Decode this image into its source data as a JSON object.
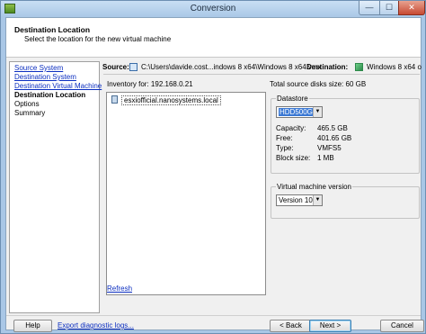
{
  "window": {
    "title": "Conversion",
    "minimize_glyph": "—",
    "maximize_glyph": "☐",
    "close_glyph": "✕"
  },
  "header": {
    "title": "Destination Location",
    "subtitle": "Select the location for the new virtual machine"
  },
  "steps": [
    {
      "label": "Source System",
      "state": "link"
    },
    {
      "label": "Destination System",
      "state": "link"
    },
    {
      "label": "Destination Virtual Machine",
      "state": "link"
    },
    {
      "label": "Destination Location",
      "state": "current"
    },
    {
      "label": "Options",
      "state": "pending"
    },
    {
      "label": "Summary",
      "state": "pending"
    }
  ],
  "source": {
    "label": "Source:",
    "value": "C:\\Users\\davide.cost...indows 8 x64\\Windows 8 x64.vmx",
    "icon": "vmx-file-icon"
  },
  "destination": {
    "label": "Destination:",
    "value": "Windows 8 x64 o",
    "icon": "vm-icon"
  },
  "inventory": {
    "label": "Inventory for:",
    "host_ip": "192.168.0.21",
    "items": [
      {
        "label": "esxiofficial.nanosystems.local",
        "icon": "host-icon"
      }
    ],
    "refresh_label": "Refresh"
  },
  "total_disks": {
    "label": "Total source disks size:",
    "value": "60 GB"
  },
  "datastore": {
    "legend": "Datastore",
    "selected": "HDD500GB",
    "arrow": "▼",
    "rows": [
      {
        "key": "Capacity:",
        "value": "465.5 GB"
      },
      {
        "key": "Free:",
        "value": "401.65 GB"
      },
      {
        "key": "Type:",
        "value": "VMFS5"
      },
      {
        "key": "Block size:",
        "value": "1 MB"
      }
    ]
  },
  "vm_version": {
    "legend": "Virtual machine version",
    "selected": "Version 10",
    "arrow": "▼"
  },
  "footer": {
    "help": "Help",
    "export": "Export diagnostic logs...",
    "back": "< Back",
    "next": "Next >",
    "cancel": "Cancel"
  },
  "colors": {
    "link": "#0b2ec0",
    "selection": "#3a78d4",
    "titlebar": "#a9c7e6"
  }
}
